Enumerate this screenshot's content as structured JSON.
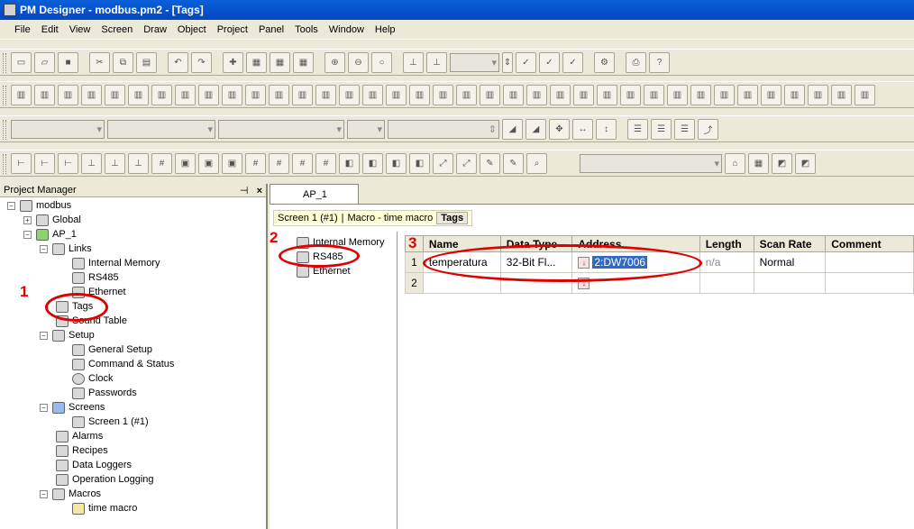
{
  "window": {
    "title": "PM Designer - modbus.pm2 - [Tags]"
  },
  "menu": [
    "File",
    "Edit",
    "View",
    "Screen",
    "Draw",
    "Object",
    "Project",
    "Panel",
    "Tools",
    "Window",
    "Help"
  ],
  "project_manager": {
    "title": "Project Manager",
    "pin": "⊣",
    "close": "×",
    "tree": [
      {
        "label": "modbus",
        "expander": "−"
      },
      {
        "label": "Global",
        "expander": "+"
      },
      {
        "label": "AP_1",
        "expander": "−"
      },
      {
        "label": "Links",
        "expander": "−"
      },
      {
        "label": "Internal Memory",
        "expander": ""
      },
      {
        "label": "RS485",
        "expander": ""
      },
      {
        "label": "Ethernet",
        "expander": ""
      },
      {
        "label": "Tags",
        "expander": ""
      },
      {
        "label": "Sound Table",
        "expander": ""
      },
      {
        "label": "Setup",
        "expander": "−"
      },
      {
        "label": "General Setup",
        "expander": ""
      },
      {
        "label": "Command & Status",
        "expander": ""
      },
      {
        "label": "Clock",
        "expander": ""
      },
      {
        "label": "Passwords",
        "expander": ""
      },
      {
        "label": "Screens",
        "expander": "−"
      },
      {
        "label": "Screen 1 (#1)",
        "expander": ""
      },
      {
        "label": "Alarms",
        "expander": ""
      },
      {
        "label": "Recipes",
        "expander": ""
      },
      {
        "label": "Data Loggers",
        "expander": ""
      },
      {
        "label": "Operation Logging",
        "expander": ""
      },
      {
        "label": "Macros",
        "expander": "−"
      },
      {
        "label": "time macro",
        "expander": ""
      }
    ]
  },
  "doc_tab": {
    "label": "AP_1"
  },
  "breadcrumb": {
    "screen": "Screen 1 (#1)",
    "macro": "Macro - time macro",
    "tags": "Tags"
  },
  "links_pane": [
    "Internal Memory",
    "RS485",
    "Ethernet"
  ],
  "tag_grid": {
    "columns": [
      "Name",
      "Data Type",
      "Address",
      "Length",
      "Scan Rate",
      "Comment"
    ],
    "rows": [
      {
        "index": "1",
        "name": "temperatura",
        "data_type": "32-Bit Fl...",
        "address": "2:DW7006",
        "length": "n/a",
        "scan_rate": "Normal",
        "comment": ""
      },
      {
        "index": "2",
        "name": "",
        "data_type": "",
        "address": "",
        "length": "",
        "scan_rate": "",
        "comment": ""
      }
    ]
  },
  "annotations": {
    "one": "1",
    "two": "2",
    "three": "3"
  },
  "colors": {
    "annotation": "#e00000",
    "selection": "#316ac5",
    "titlebar": "#0a5fd8"
  }
}
